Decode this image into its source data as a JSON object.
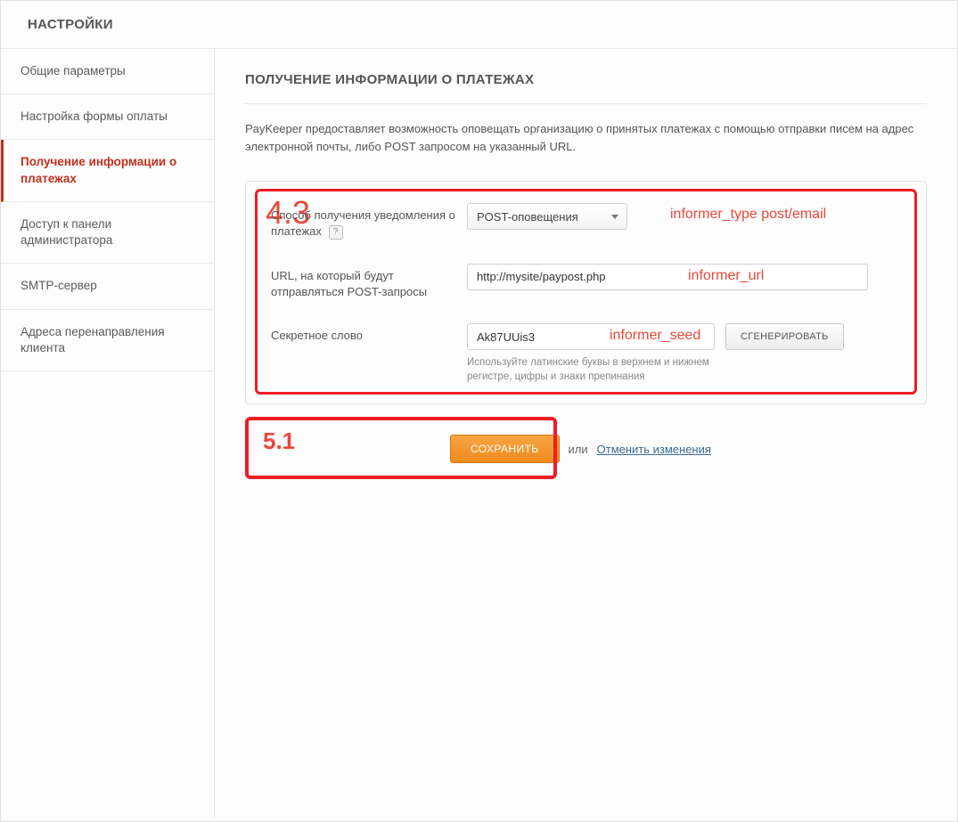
{
  "header": {
    "title": "НАСТРОЙКИ"
  },
  "sidebar": {
    "items": [
      {
        "label": "Общие параметры"
      },
      {
        "label": "Настройка формы оплаты"
      },
      {
        "label": "Получение информации о платежах"
      },
      {
        "label": "Доступ к панели администратора"
      },
      {
        "label": "SMTP-сервер"
      },
      {
        "label": "Адреса перенаправления клиента"
      }
    ],
    "active_index": 2
  },
  "main": {
    "section_title": "ПОЛУЧЕНИЕ ИНФОРМАЦИИ О ПЛАТЕЖАХ",
    "intro": "PayKeeper предоставляет возможность оповещать организацию о принятых платежах с помощью отправки писем на адрес электронной почты, либо POST запросом на указанный URL."
  },
  "form": {
    "row1": {
      "label": "Способ получения уведомления о платежах",
      "help": "?",
      "select_value": "POST-оповещения"
    },
    "row2": {
      "label": "URL, на который будут отправляться  POST-запросы",
      "value": "http://mysite/paypost.php"
    },
    "row3": {
      "label": "Секретное слово",
      "value": "Ak87UUis3",
      "button": "СГЕНЕРИРОВАТЬ",
      "hint": "Используйте латинские буквы в верхнем и нижнем регистре, цифры и знаки препинания"
    }
  },
  "actions": {
    "save": "СОХРАНИТЬ",
    "or": "или",
    "cancel": "Отменить изменения"
  },
  "annotations": {
    "n43": "4.3",
    "n51": "5.1",
    "a1": "informer_type   post/email",
    "a2": "informer_url",
    "a3": "informer_seed"
  }
}
